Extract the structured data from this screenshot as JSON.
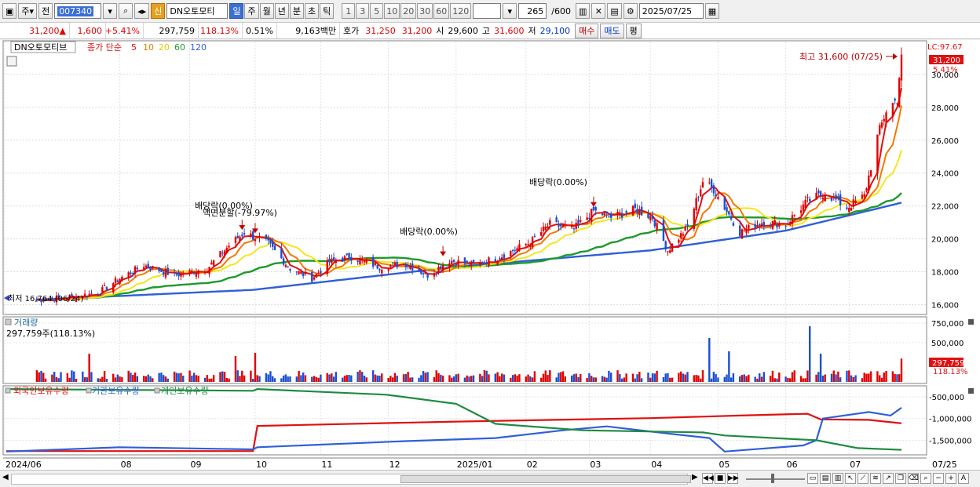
{
  "toolbar": {
    "period_btn": "주",
    "prev_btn": "전",
    "stock_code": "007340",
    "new_badge": "신",
    "stock_name": "DN오토모티",
    "intervals": [
      "일",
      "주",
      "월",
      "년",
      "분",
      "초",
      "틱"
    ],
    "selected_interval": "일",
    "minute_options": [
      "1",
      "3",
      "5",
      "10",
      "20",
      "30",
      "60",
      "120"
    ],
    "count": "265",
    "count_total": "/600",
    "date": "2025/07/25"
  },
  "quote": {
    "price": "31,200",
    "change": "1,600",
    "change_pct": "+5.41%",
    "volume": "297,759",
    "volume_ratio": "118.13%",
    "turnover_pct": "0.51%",
    "amount": "9,163백만",
    "ask_label": "호가",
    "ask1": "31,250",
    "ask2": "31,200",
    "open_label": "시",
    "open": "29,600",
    "high_label": "고",
    "high": "31,600",
    "low_label": "저",
    "low": "29,100",
    "buy_btn": "매수",
    "sell_btn": "매도",
    "eval_btn": "평"
  },
  "colors": {
    "ma5": "#e01010",
    "ma10": "#f07a00",
    "ma20": "#f5e61c",
    "ma60": "#1e9a2a",
    "ma120": "#2f5fd8",
    "up": "#e00000",
    "down": "#1a4fd0"
  },
  "chart_data": [
    {
      "type": "candlestick",
      "title": "DN오토모티브",
      "legend": [
        "종가 단순",
        "5",
        "10",
        "20",
        "60",
        "120"
      ],
      "x_tick_labels": [
        "2024/06",
        "08",
        "09",
        "10",
        "11",
        "12",
        "2025/01",
        "02",
        "03",
        "04",
        "05",
        "06",
        "07",
        "07/25"
      ],
      "y_tick_labels": [
        "16,000",
        "18,000",
        "20,000",
        "22,000",
        "24,000",
        "26,000",
        "28,000",
        "30,000"
      ],
      "ylim": [
        15500,
        31900
      ],
      "last_price_label": "31,200",
      "last_change_label": "5.41%",
      "lc_label": "LC:97.67",
      "annotations": [
        {
          "text": "최고 31,600 (07/25)",
          "date": "2025-07-25",
          "value": 31600
        },
        {
          "text": "최저 16,764 (06/24)",
          "date": "2024-06-24",
          "value": 16764
        },
        {
          "text": "배당락(0.00%)",
          "date": "2024-09-26"
        },
        {
          "text": "액면분할(-79.97%)",
          "date": "2024-10-02"
        },
        {
          "text": "배당락(0.00%)",
          "date": "2024-12-27"
        },
        {
          "text": "배당락(0.00%)",
          "date": "2025-03-06"
        }
      ],
      "close_points": [
        {
          "date": "2024-06-24",
          "value": 16300
        },
        {
          "date": "2024-07-05",
          "value": 16400
        },
        {
          "date": "2024-07-22",
          "value": 16700
        },
        {
          "date": "2024-08-01",
          "value": 17600
        },
        {
          "date": "2024-08-12",
          "value": 18400
        },
        {
          "date": "2024-08-26",
          "value": 17800
        },
        {
          "date": "2024-09-10",
          "value": 18200
        },
        {
          "date": "2024-09-20",
          "value": 19600
        },
        {
          "date": "2024-09-27",
          "value": 20400
        },
        {
          "date": "2024-10-08",
          "value": 19700
        },
        {
          "date": "2024-10-18",
          "value": 18200
        },
        {
          "date": "2024-10-28",
          "value": 17600
        },
        {
          "date": "2024-11-05",
          "value": 18600
        },
        {
          "date": "2024-11-15",
          "value": 18900
        },
        {
          "date": "2024-11-28",
          "value": 18300
        },
        {
          "date": "2024-12-10",
          "value": 18500
        },
        {
          "date": "2024-12-20",
          "value": 17800
        },
        {
          "date": "2024-12-30",
          "value": 18700
        },
        {
          "date": "2025-01-10",
          "value": 18400
        },
        {
          "date": "2025-01-22",
          "value": 18900
        },
        {
          "date": "2025-02-05",
          "value": 19800
        },
        {
          "date": "2025-02-14",
          "value": 20900
        },
        {
          "date": "2025-02-25",
          "value": 20600
        },
        {
          "date": "2025-03-06",
          "value": 21700
        },
        {
          "date": "2025-03-14",
          "value": 21300
        },
        {
          "date": "2025-03-25",
          "value": 21800
        },
        {
          "date": "2025-04-02",
          "value": 21300
        },
        {
          "date": "2025-04-09",
          "value": 19300
        },
        {
          "date": "2025-04-18",
          "value": 20700
        },
        {
          "date": "2025-04-25",
          "value": 23500
        },
        {
          "date": "2025-04-30",
          "value": 23000
        },
        {
          "date": "2025-05-12",
          "value": 20400
        },
        {
          "date": "2025-05-22",
          "value": 21000
        },
        {
          "date": "2025-06-02",
          "value": 20900
        },
        {
          "date": "2025-06-12",
          "value": 22300
        },
        {
          "date": "2025-06-20",
          "value": 22800
        },
        {
          "date": "2025-06-30",
          "value": 21900
        },
        {
          "date": "2025-07-08",
          "value": 22600
        },
        {
          "date": "2025-07-14",
          "value": 26200
        },
        {
          "date": "2025-07-18",
          "value": 27800
        },
        {
          "date": "2025-07-23",
          "value": 28500
        },
        {
          "date": "2025-07-25",
          "value": 31200
        }
      ],
      "ma120_points": [
        {
          "date": "2024-06-24",
          "value": 16300
        },
        {
          "date": "2024-10-01",
          "value": 16900
        },
        {
          "date": "2025-01-02",
          "value": 18300
        },
        {
          "date": "2025-04-01",
          "value": 19300
        },
        {
          "date": "2025-06-02",
          "value": 20500
        },
        {
          "date": "2025-07-25",
          "value": 22200
        }
      ]
    },
    {
      "type": "bar",
      "title": "거래량",
      "value_label": "297,759주(118.13%)",
      "y_tick_labels": [
        "500,000",
        "750,000"
      ],
      "last_label": "297,759",
      "last_ratio_label": "118.13%",
      "ylim": [
        0,
        800000
      ],
      "spikes": [
        {
          "date": "2024-07-18",
          "value": 360000
        },
        {
          "date": "2024-09-23",
          "value": 330000
        },
        {
          "date": "2024-10-02",
          "value": 370000
        },
        {
          "date": "2025-04-28",
          "value": 560000
        },
        {
          "date": "2025-05-07",
          "value": 390000
        },
        {
          "date": "2025-06-13",
          "value": 710000
        },
        {
          "date": "2025-06-18",
          "value": 360000
        },
        {
          "date": "2025-07-25",
          "value": 297759
        }
      ]
    },
    {
      "type": "line",
      "series": [
        {
          "name": "외국인보유수량",
          "color": "#e01010"
        },
        {
          "name": "기관보유수량",
          "color": "#2f5fd8"
        },
        {
          "name": "개인보유수량",
          "color": "#1e8a40"
        }
      ],
      "y_tick_labels": [
        "-500,000",
        "-1,000,000",
        "-1,500,000"
      ],
      "ylim": [
        -1800000,
        -300000
      ]
    }
  ],
  "scroll": {
    "left_arrow": "◀",
    "right_arrow": "▶"
  }
}
